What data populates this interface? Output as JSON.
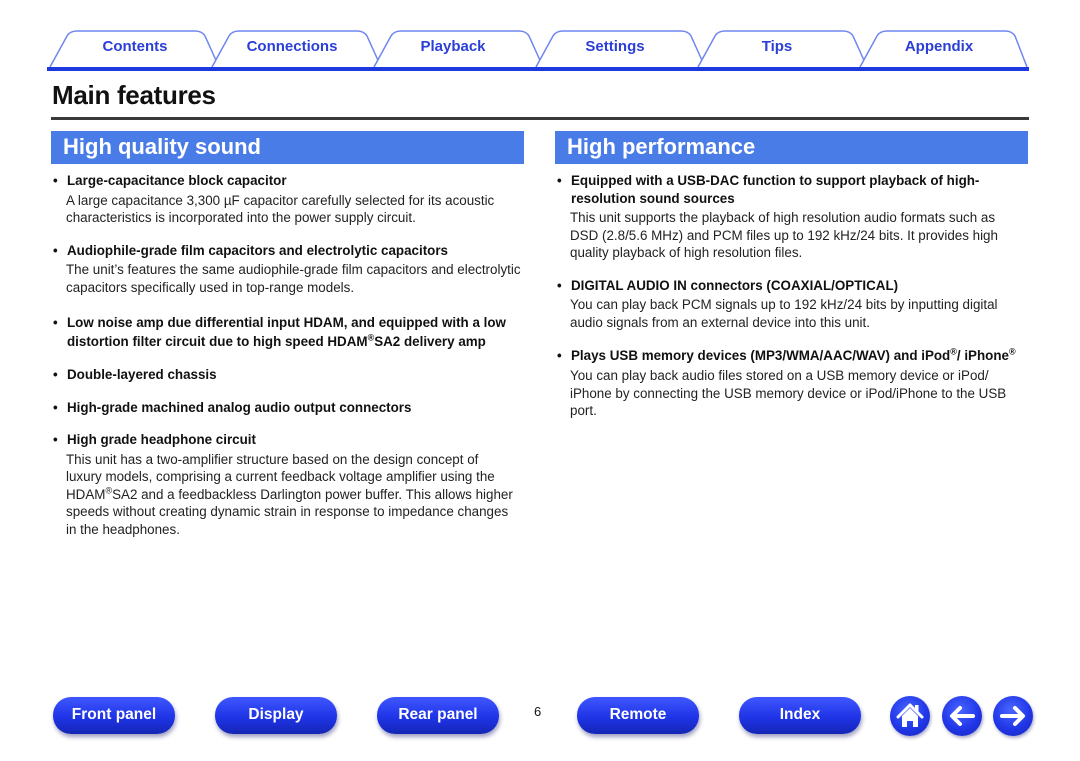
{
  "tabs": [
    {
      "label": "Contents"
    },
    {
      "label": "Connections"
    },
    {
      "label": "Playback"
    },
    {
      "label": "Settings"
    },
    {
      "label": "Tips"
    },
    {
      "label": "Appendix"
    }
  ],
  "page_title": "Main features",
  "colors": {
    "tab_text": "#2b3fd6",
    "tab_line": "#1f39e0",
    "section_header_bg": "#4a7ce8",
    "button_blue": "#1f34e6"
  },
  "left": {
    "heading": "High quality sound",
    "items": [
      {
        "title": "Large-capacitance block capacitor",
        "desc": "A large capacitance 3,300 µF capacitor carefully selected for its acoustic characteristics is incorporated into the power supply circuit."
      },
      {
        "title": "Audiophile-grade film capacitors and electrolytic capacitors",
        "desc": "The unit’s features the same audiophile-grade film capacitors and electrolytic capacitors specifically used in top-range models."
      },
      {
        "title_a": "Low noise amp due differential input HDAM, and equipped with a low distortion filter circuit due to high speed HDAM",
        "title_sup": "®",
        "title_b": "SA2 delivery amp"
      },
      {
        "title": "Double-layered chassis"
      },
      {
        "title": "High-grade machined analog audio output connectors"
      },
      {
        "title": "High grade headphone circuit",
        "desc_a": "This unit has a two-amplifier structure based on the design concept of luxury models, comprising a current feedback voltage amplifier using the HDAM",
        "desc_sup": "®",
        "desc_b": "SA2 and a feedbackless Darlington power buffer. This allows higher speeds without creating dynamic strain in response to impedance changes in the headphones."
      }
    ]
  },
  "right": {
    "heading": "High performance",
    "items": [
      {
        "title": "Equipped with a USB-DAC function to support playback of high-resolution sound sources",
        "desc": "This unit supports the playback of high resolution audio formats such as DSD (2.8/5.6 MHz) and PCM files up to 192 kHz/24 bits. It provides high quality playback of high resolution files."
      },
      {
        "title": "DIGITAL AUDIO IN connectors (COAXIAL/OPTICAL)",
        "desc": "You can play back PCM signals up to 192 kHz/24 bits by inputting digital audio signals from an external device into this unit."
      },
      {
        "title_a": "Plays USB memory devices (MP3/WMA/AAC/WAV) and iPod",
        "title_sup": "®",
        "title_b": "/ iPhone",
        "title_sup2": "®",
        "desc": "You can play back audio files stored on a USB memory device or iPod/ iPhone by connecting the USB memory device or iPod/iPhone to the USB port."
      }
    ]
  },
  "bullet": "•",
  "footer": {
    "buttons": [
      {
        "label": "Front panel"
      },
      {
        "label": "Display"
      },
      {
        "label": "Rear panel"
      },
      {
        "label": "Remote"
      },
      {
        "label": "Index"
      }
    ],
    "page_number": "6",
    "icons": [
      "home-icon",
      "back-arrow-icon",
      "forward-arrow-icon"
    ]
  }
}
